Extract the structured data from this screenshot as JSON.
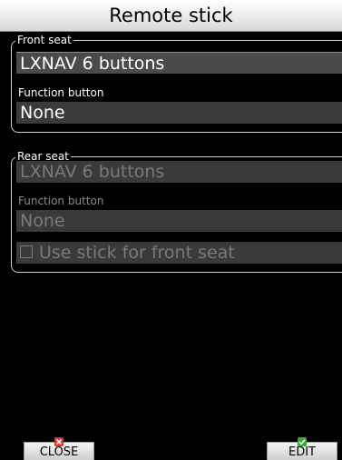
{
  "title": "Remote stick",
  "front_seat": {
    "legend": "Front seat",
    "stick_value": "LXNAV 6 buttons",
    "function_label": "Function button",
    "function_value": "None"
  },
  "rear_seat": {
    "legend": "Rear seat",
    "stick_value": "LXNAV 6 buttons",
    "function_label": "Function button",
    "function_value": "None",
    "use_stick_label": "Use stick for front seat",
    "use_stick_checked": false
  },
  "softkeys": {
    "close_label": "CLOSE",
    "close_indicator_color": "#e03030",
    "edit_label": "EDIT",
    "edit_indicator_color": "#30b030"
  },
  "colors": {
    "background": "#000000",
    "field": "#3b3b3b",
    "disabled_text": "#7a7a7a"
  }
}
